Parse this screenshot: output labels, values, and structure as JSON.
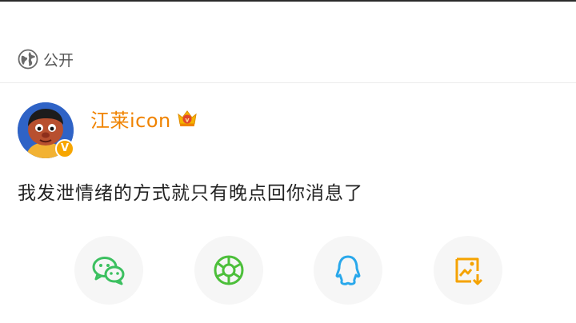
{
  "visibility": {
    "label": "公开",
    "icon": "globe-icon"
  },
  "post": {
    "author": "江莱icon",
    "author_badge": "crown-vip-icon",
    "verified_badge": "V",
    "text": "我发泄情绪的方式就只有晚点回你消息了"
  },
  "share": {
    "targets": [
      {
        "icon": "wechat-icon",
        "color": "#3cc060"
      },
      {
        "icon": "moments-icon",
        "color": "#4cbf3a"
      },
      {
        "icon": "qq-icon",
        "color": "#29a8eb"
      },
      {
        "icon": "save-image-icon",
        "color": "#f5a300"
      }
    ]
  },
  "colors": {
    "author": "#f08300",
    "share_bg": "#f6f6f6"
  }
}
